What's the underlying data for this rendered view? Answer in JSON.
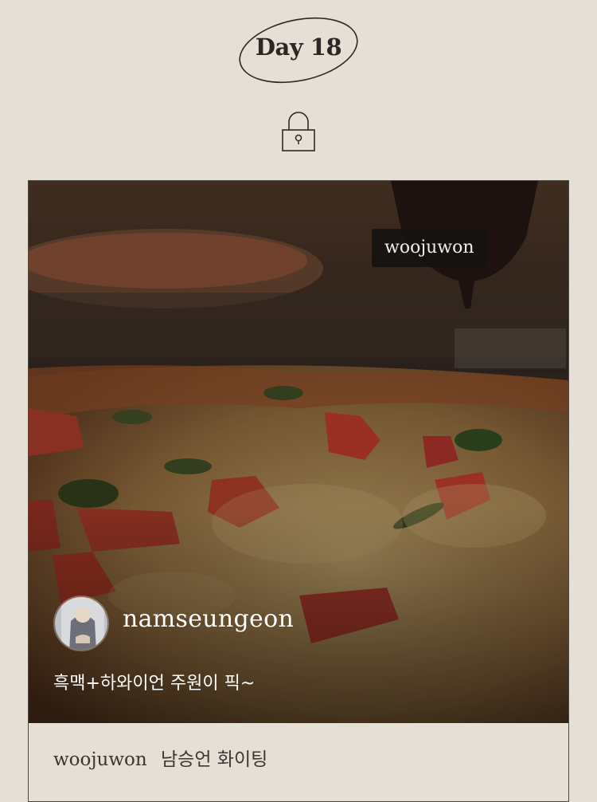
{
  "header": {
    "day_label": "Day 18",
    "lock_icon": "lock-icon"
  },
  "post": {
    "photo_alt": "pizza-photo",
    "tag_label": "woojuwon",
    "author": {
      "username": "namseungeon",
      "avatar_icon": "avatar"
    },
    "caption": "흑맥+하와이언 주원이 픽~"
  },
  "comment": {
    "username": "woojuwon",
    "text": "남승언 화이팅"
  },
  "colors": {
    "background": "#e6dfd5",
    "text_dark": "#2b2724",
    "tag_bg": "#141211"
  }
}
